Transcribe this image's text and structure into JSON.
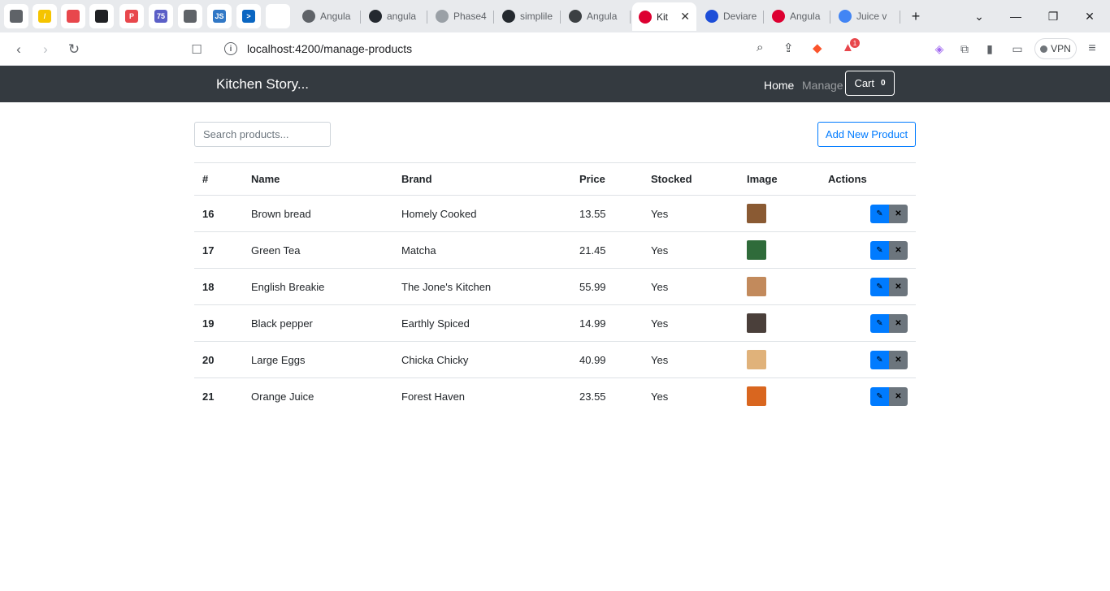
{
  "browser": {
    "pinned_tabs": [
      {
        "icon": "globe-icon",
        "color": "#5f6368",
        "text": ""
      },
      {
        "icon": "pen-icon",
        "color": "#f5c400",
        "text": "/"
      },
      {
        "icon": "cube-icon",
        "color": "#e8474c",
        "text": ""
      },
      {
        "icon": "crown-icon",
        "color": "#202124",
        "text": ""
      },
      {
        "icon": "p-logo-icon",
        "color": "#e8474c",
        "text": "P"
      },
      {
        "icon": "badge-75-icon",
        "color": "#5b5fc7",
        "text": "75"
      },
      {
        "icon": "globe-icon",
        "color": "#5f6368",
        "text": ""
      },
      {
        "icon": "js-icon",
        "color": "#3178c6",
        "text": "JS"
      },
      {
        "icon": "terminal-icon",
        "color": "#0a66c2",
        "text": ">"
      },
      {
        "icon": "blank-icon",
        "color": "#ffffff",
        "text": ""
      }
    ],
    "tabs": [
      {
        "label": "Angula",
        "icon": "angular-globe-icon",
        "color": "#5f6368"
      },
      {
        "label": "angula",
        "icon": "github-icon",
        "color": "#24292f"
      },
      {
        "label": "Phase4",
        "icon": "loading-icon",
        "color": "#9aa0a6"
      },
      {
        "label": "simplile",
        "icon": "github-icon",
        "color": "#24292f"
      },
      {
        "label": "Angula",
        "icon": "openai-icon",
        "color": "#3c4043"
      },
      {
        "label": "Kit",
        "icon": "angular-icon",
        "color": "#dd0031",
        "active": true
      },
      {
        "label": "Deviare",
        "icon": "deviare-icon",
        "color": "#1d4ed8"
      },
      {
        "label": "Angula",
        "icon": "angular-icon",
        "color": "#dd0031"
      },
      {
        "label": "Juice v",
        "icon": "forms-icon",
        "color": "#4285f4"
      }
    ],
    "close_glyph": "✕",
    "new_tab_glyph": "+",
    "url": "localhost:4200/manage-products",
    "vpn_label": "VPN",
    "alert_count": "1"
  },
  "navbar": {
    "brand": "Kitchen Story...",
    "home_label": "Home",
    "manage_label": "Manage",
    "cart_label": "Cart",
    "cart_count": "0"
  },
  "toolbar": {
    "search_placeholder": "Search products...",
    "add_label": "Add New Product"
  },
  "table": {
    "headers": [
      "#",
      "Name",
      "Brand",
      "Price",
      "Stocked",
      "Image",
      "Actions"
    ],
    "rows": [
      {
        "id": "16",
        "name": "Brown bread",
        "brand": "Homely Cooked",
        "price": "13.55",
        "stocked": "Yes",
        "thumb_color": "#8a5a33"
      },
      {
        "id": "17",
        "name": "Green Tea",
        "brand": "Matcha",
        "price": "21.45",
        "stocked": "Yes",
        "thumb_color": "#2f6b3a"
      },
      {
        "id": "18",
        "name": "English Breakie",
        "brand": "The Jone's Kitchen",
        "price": "55.99",
        "stocked": "Yes",
        "thumb_color": "#c28a5c"
      },
      {
        "id": "19",
        "name": "Black pepper",
        "brand": "Earthly Spiced",
        "price": "14.99",
        "stocked": "Yes",
        "thumb_color": "#4a3f3a"
      },
      {
        "id": "20",
        "name": "Large Eggs",
        "brand": "Chicka Chicky",
        "price": "40.99",
        "stocked": "Yes",
        "thumb_color": "#e0b27a"
      },
      {
        "id": "21",
        "name": "Orange Juice",
        "brand": "Forest Haven",
        "price": "23.55",
        "stocked": "Yes",
        "thumb_color": "#d9661f"
      }
    ],
    "edit_glyph": "✎",
    "delete_glyph": "✕"
  }
}
